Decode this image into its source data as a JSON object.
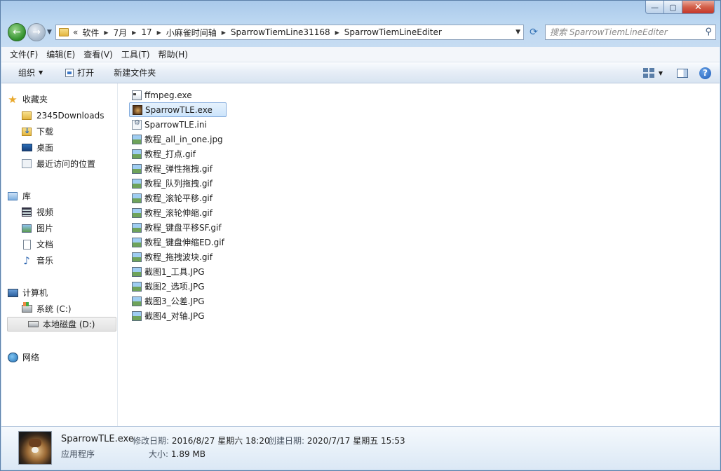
{
  "window": {
    "controls": {
      "minimize": "—",
      "maximize": "▢",
      "close": "✕"
    }
  },
  "nav": {
    "back_glyph": "←",
    "forward_glyph": "→",
    "address": {
      "overflow": "«",
      "crumbs": [
        "软件",
        "7月",
        "17",
        "小麻雀时间轴",
        "SparrowTiemLine31168",
        "SparrowTiemLineEditer"
      ]
    },
    "refresh_glyph": "⟳",
    "search_placeholder": "搜索 SparrowTiemLineEditer"
  },
  "menubar": [
    "文件(F)",
    "编辑(E)",
    "查看(V)",
    "工具(T)",
    "帮助(H)"
  ],
  "toolbar": {
    "organize": "组织",
    "open": "打开",
    "new_folder": "新建文件夹",
    "help": "?"
  },
  "sidebar": {
    "favorites": {
      "label": "收藏夹",
      "items": [
        "2345Downloads",
        "下载",
        "桌面",
        "最近访问的位置"
      ]
    },
    "libraries": {
      "label": "库",
      "items": [
        "视频",
        "图片",
        "文档",
        "音乐"
      ]
    },
    "computer": {
      "label": "计算机",
      "items": [
        "系统 (C:)",
        "本地磁盘 (D:)"
      ],
      "selected": "本地磁盘 (D:)"
    },
    "network": {
      "label": "网络"
    }
  },
  "files": [
    {
      "name": "ffmpeg.exe",
      "icon": "exe"
    },
    {
      "name": "SparrowTLE.exe",
      "icon": "app",
      "selected": true
    },
    {
      "name": "SparrowTLE.ini",
      "icon": "ini"
    },
    {
      "name": "教程_all_in_one.jpg",
      "icon": "img"
    },
    {
      "name": "教程_打点.gif",
      "icon": "img"
    },
    {
      "name": "教程_弹性拖拽.gif",
      "icon": "img"
    },
    {
      "name": "教程_队列拖拽.gif",
      "icon": "img"
    },
    {
      "name": "教程_滚轮平移.gif",
      "icon": "img"
    },
    {
      "name": "教程_滚轮伸缩.gif",
      "icon": "img"
    },
    {
      "name": "教程_键盘平移SF.gif",
      "icon": "img"
    },
    {
      "name": "教程_键盘伸缩ED.gif",
      "icon": "img"
    },
    {
      "name": "教程_拖拽波块.gif",
      "icon": "img"
    },
    {
      "name": "截图1_工具.JPG",
      "icon": "img"
    },
    {
      "name": "截图2_选项.JPG",
      "icon": "img"
    },
    {
      "name": "截图3_公差.JPG",
      "icon": "img"
    },
    {
      "name": "截图4_对轴.JPG",
      "icon": "img"
    }
  ],
  "details": {
    "name": "SparrowTLE.exe",
    "type": "应用程序",
    "modified_label": "修改日期:",
    "modified_value": "2016/8/27 星期六 18:20",
    "created_label": "创建日期:",
    "created_value": "2020/7/17 星期五 15:53",
    "size_label": "大小:",
    "size_value": "1.89 MB"
  }
}
